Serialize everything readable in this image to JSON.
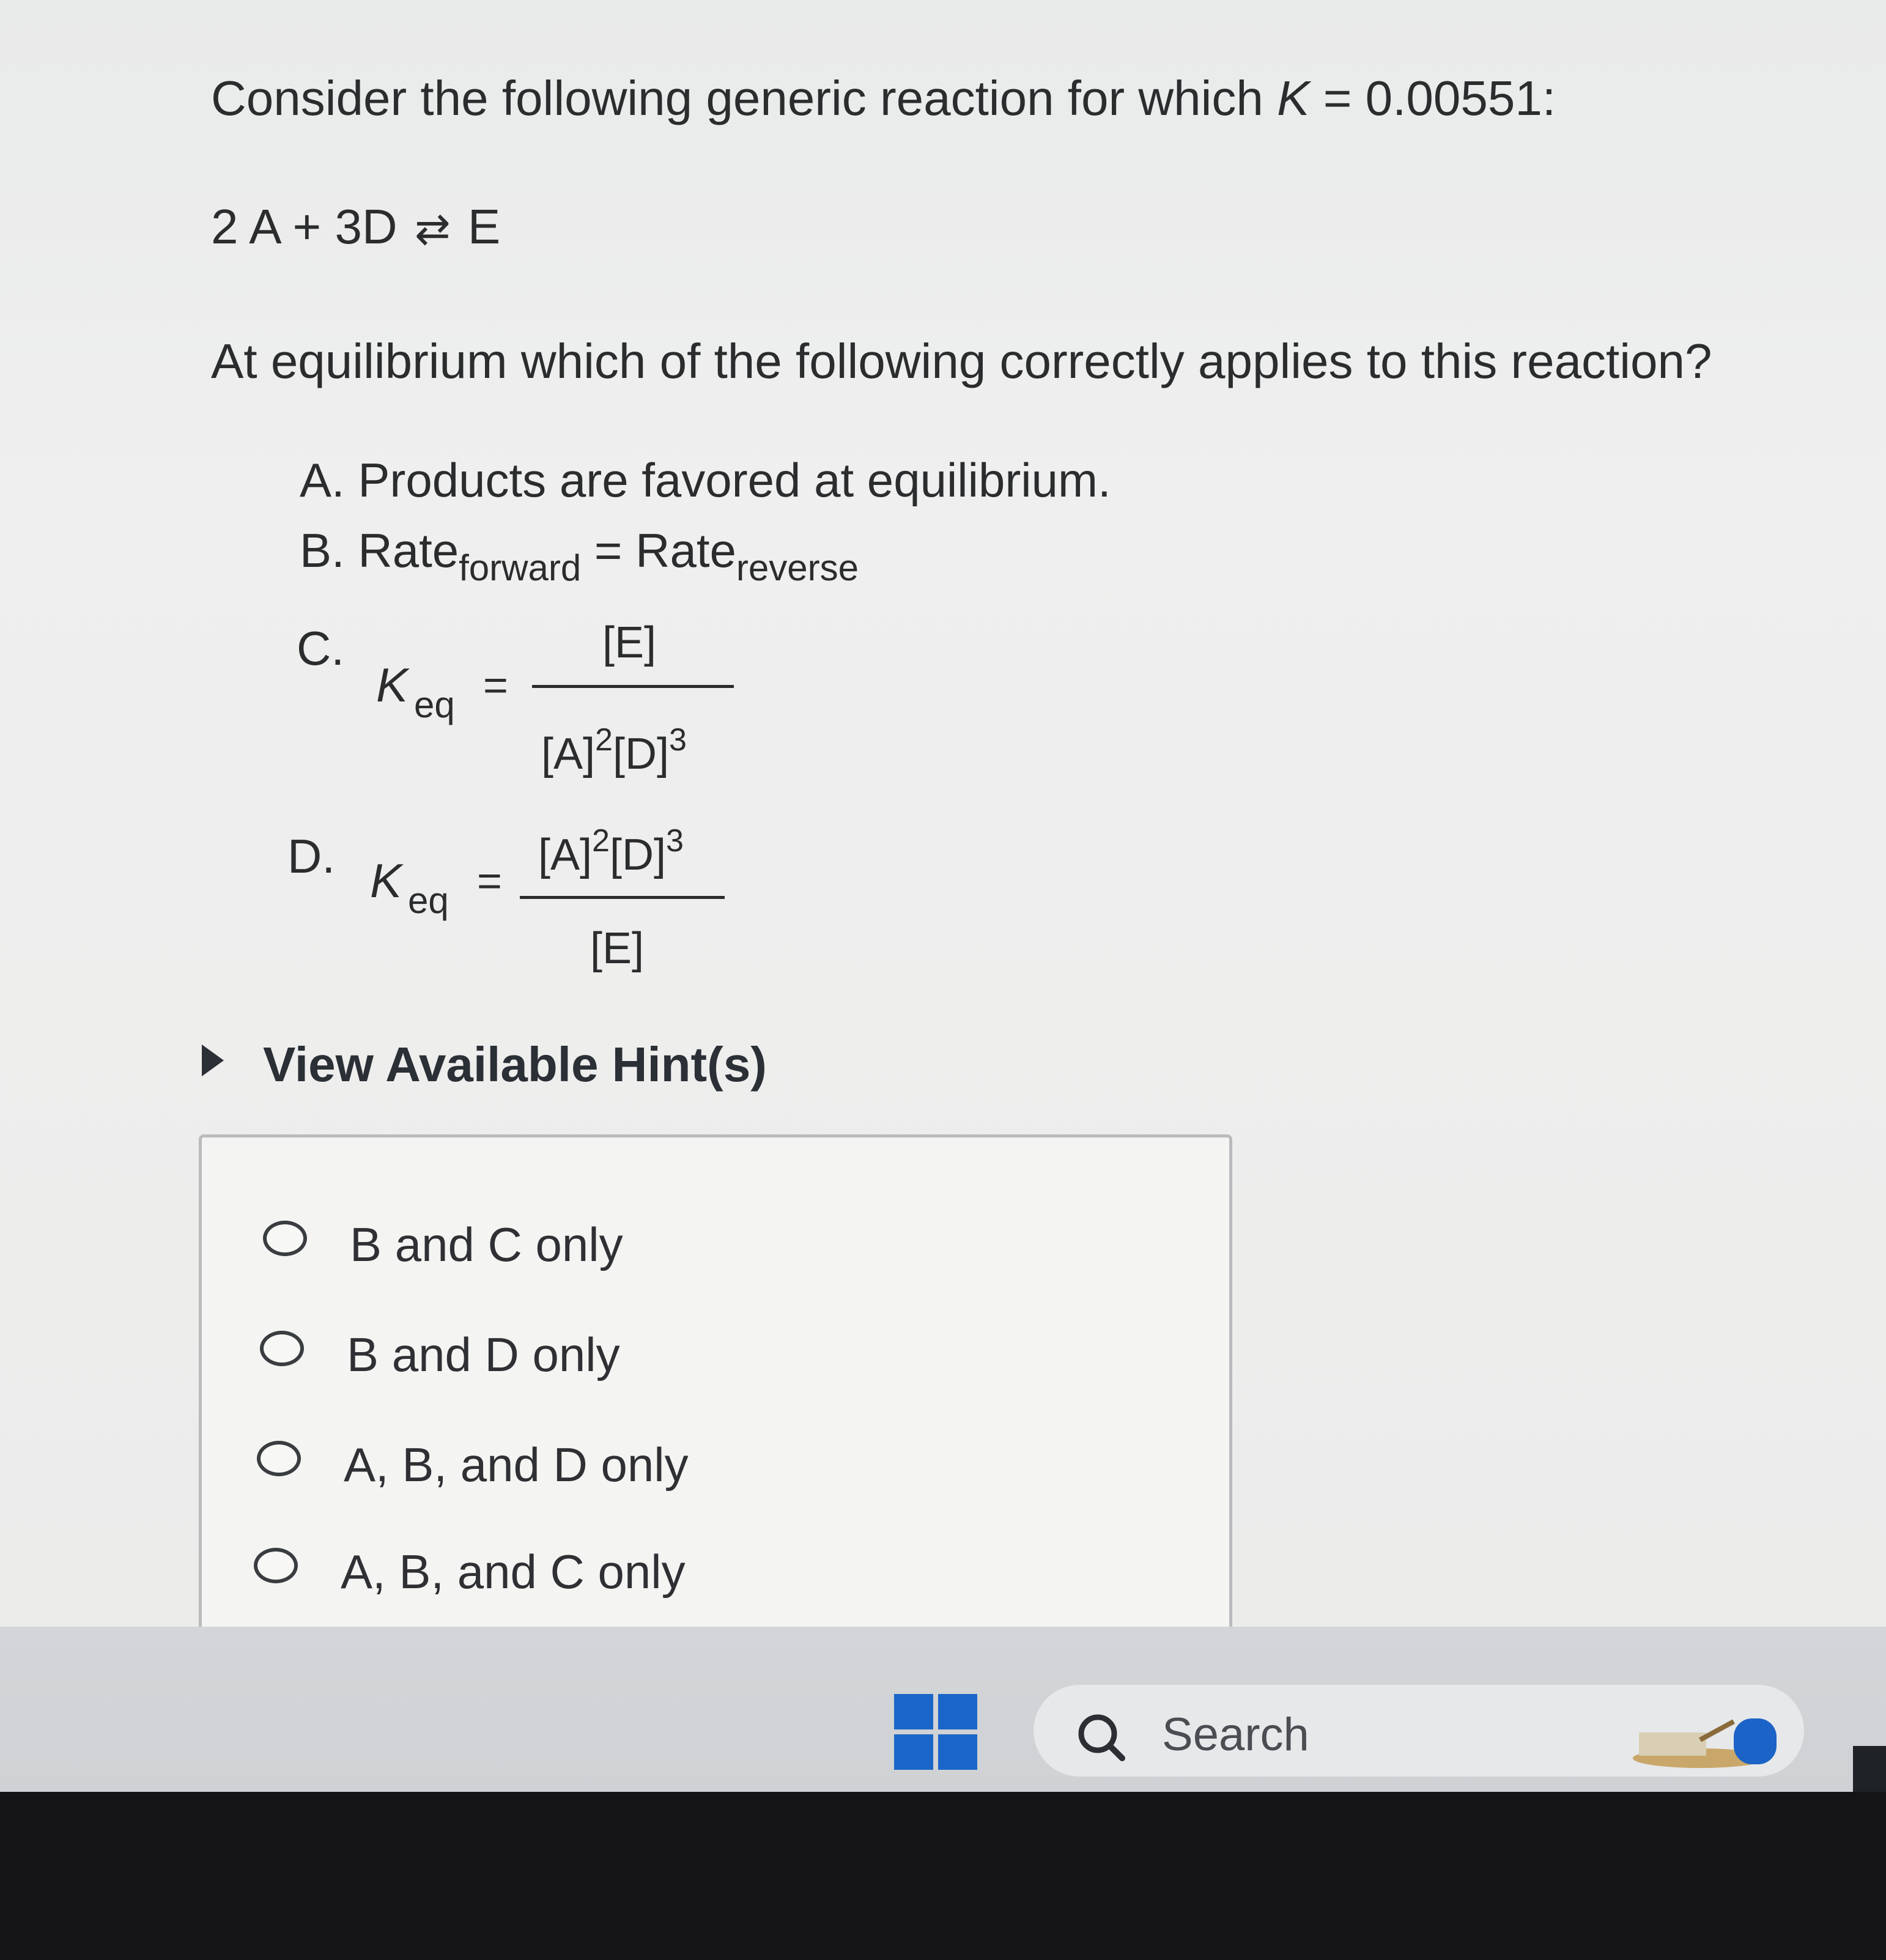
{
  "question": {
    "intro": "Consider the following generic reaction for which ",
    "k_symbol": "K",
    "k_value": " = 0.00551:",
    "reaction": {
      "reactant_1": "2 A",
      "plus": "+",
      "reactant_2": "3D",
      "arrow": "⇄",
      "product": "E"
    },
    "prompt": "At equilibrium which of the following correctly applies to this reaction?"
  },
  "statements": {
    "a": "A. Products are favored at equilibrium.",
    "b": {
      "prefix": "B. Rate",
      "sub_forward": "forward",
      "equals": " = Rate",
      "sub_reverse": "reverse"
    },
    "c": {
      "letter": "C.",
      "k": "K",
      "k_sub": "eq",
      "equals": "=",
      "numerator": "[E]",
      "denominator": {
        "a": "[A]",
        "a_exp": "2",
        "d": "[D]",
        "d_exp": "3"
      }
    },
    "d": {
      "letter": "D.",
      "k": "K",
      "k_sub": "eq",
      "equals": "=",
      "numerator": {
        "a": "[A]",
        "a_exp": "2",
        "d": "[D]",
        "d_exp": "3"
      },
      "denominator": "[E]"
    }
  },
  "hint": {
    "label": "View Available Hint(s)"
  },
  "choices": [
    {
      "label": "B and C only"
    },
    {
      "label": "B and D only"
    },
    {
      "label": "A, B, and D only"
    },
    {
      "label": "A, B, and C only"
    }
  ],
  "taskbar": {
    "search_label": "Search",
    "start_icon": "windows-logo-icon",
    "search_icon": "search-icon",
    "accent_color": "#1a66c8"
  }
}
